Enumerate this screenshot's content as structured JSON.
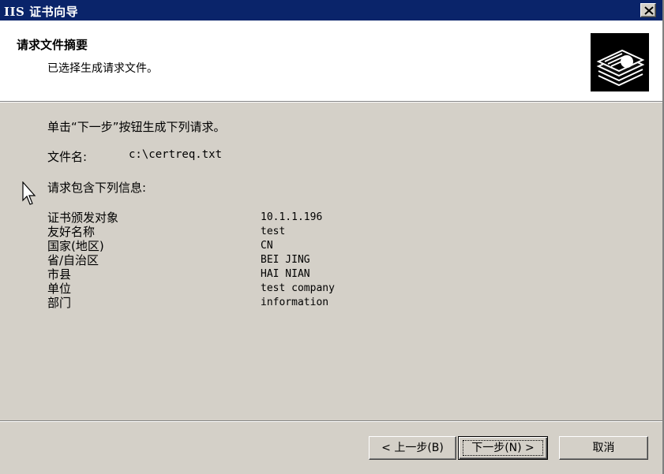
{
  "window": {
    "title": "IIS 证书向导"
  },
  "header": {
    "title": "请求文件摘要",
    "subtitle": "已选择生成请求文件。"
  },
  "content": {
    "instruction": "单击“下一步”按钮生成下列请求。",
    "filename_label": "文件名:",
    "filename_value": "c:\\certreq.txt",
    "info_label": "请求包含下列信息:",
    "fields": [
      {
        "label": "证书颁发对象",
        "value": "10.1.1.196"
      },
      {
        "label": "友好名称",
        "value": "test"
      },
      {
        "label": "国家(地区)",
        "value": "CN"
      },
      {
        "label": "省/自治区",
        "value": "BEI JING"
      },
      {
        "label": "市县",
        "value": "HAI NIAN"
      },
      {
        "label": "单位",
        "value": "test company"
      },
      {
        "label": "部门",
        "value": "information"
      }
    ]
  },
  "buttons": {
    "back": "< 上一步(B)",
    "next": "下一步(N) >",
    "cancel": "取消"
  },
  "colors": {
    "titlebar": "#0a246a",
    "face": "#d4d0c8"
  }
}
